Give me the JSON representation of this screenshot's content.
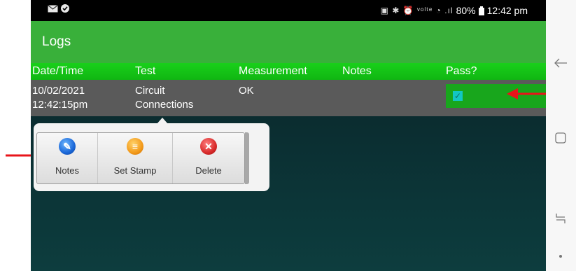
{
  "status": {
    "battery_pct": "80%",
    "time": "12:42 pm",
    "indicators": [
      "image-icon",
      "bluetooth-icon",
      "alarm-icon",
      "volte-icon",
      "wifi-icon",
      "signal-icon",
      "battery-icon"
    ]
  },
  "app": {
    "title": "Logs",
    "accent": "#39b03a"
  },
  "table": {
    "headers": {
      "datetime": "Date/Time",
      "test": "Test",
      "measurement": "Measurement",
      "notes": "Notes",
      "pass": "Pass?"
    },
    "rows": [
      {
        "date": "10/02/2021",
        "time": "12:42:15pm",
        "test_line1": "Circuit",
        "test_line2": "Connections",
        "measurement": "OK",
        "notes": "",
        "pass": true
      }
    ]
  },
  "popup": {
    "actions": [
      {
        "label": "Notes",
        "icon": "pencil-icon"
      },
      {
        "label": "Set Stamp",
        "icon": "stamp-icon"
      },
      {
        "label": "Delete",
        "icon": "close-icon"
      }
    ]
  },
  "nav": [
    "back-icon",
    "recents-icon",
    "home-icon"
  ],
  "annotation_color": "#e8141a"
}
